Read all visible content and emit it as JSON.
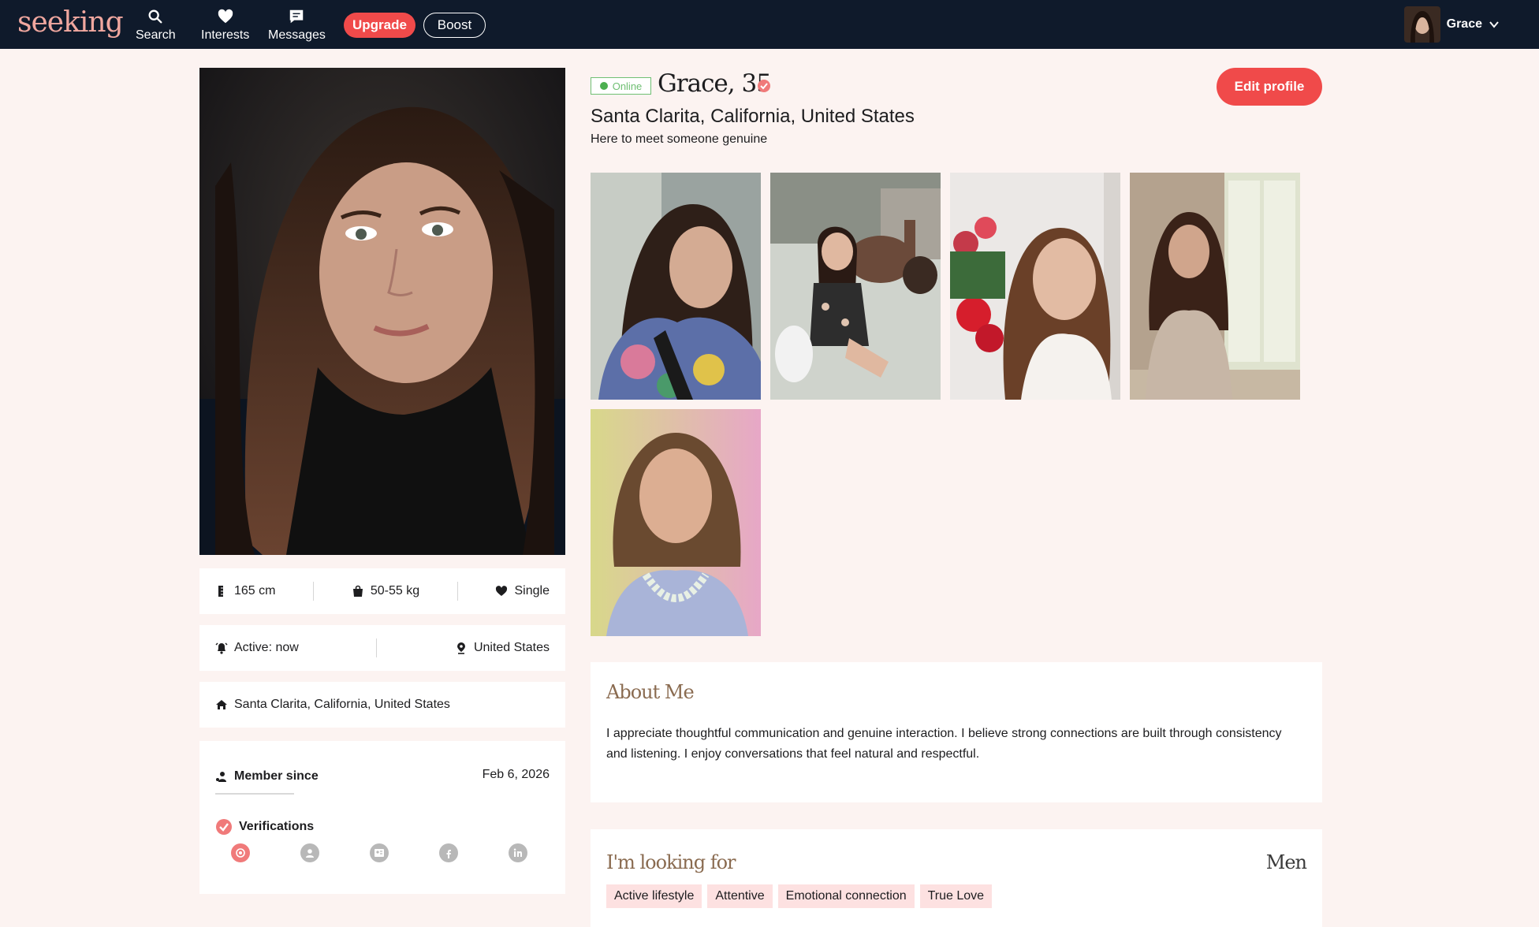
{
  "app": {
    "logo_text": "seeking"
  },
  "nav": {
    "items": [
      {
        "label": "Search",
        "icon": "search-icon"
      },
      {
        "label": "Interests",
        "icon": "heart-icon"
      },
      {
        "label": "Messages",
        "icon": "message-icon"
      }
    ],
    "upgrade_label": "Upgrade",
    "boost_label": "Boost",
    "user_name": "Grace"
  },
  "profile": {
    "online_label": "Online",
    "name_age": "Grace, 35",
    "location": "Santa Clarita, California, United States",
    "tagline": "Here to meet someone genuine",
    "edit_label": "Edit profile"
  },
  "stats": {
    "height": "165 cm",
    "weight": "50-55 kg",
    "status": "Single",
    "active": "Active: now",
    "country": "United States",
    "city": "Santa Clarita, California, United States",
    "member_since_label": "Member since",
    "member_since_value": "Feb 6, 2026",
    "verifications_label": "Verifications"
  },
  "about": {
    "title": "About Me",
    "text": "I appreciate thoughtful communication and genuine interaction. I believe strong connections are built through consistency and listening. I enjoy conversations that feel natural and respectful."
  },
  "looking_for": {
    "title": "I'm looking for",
    "gender": "Men",
    "tags": [
      "Active lifestyle",
      "Attentive",
      "Emotional connection",
      "True Love"
    ]
  },
  "colors": {
    "accent": "#f04a4a",
    "nav_bg": "#0f1a2b",
    "page_bg": "#fcf3f1",
    "online": "#4caf50",
    "tag_bg": "#fde1e1",
    "heading": "#8a6b50"
  }
}
